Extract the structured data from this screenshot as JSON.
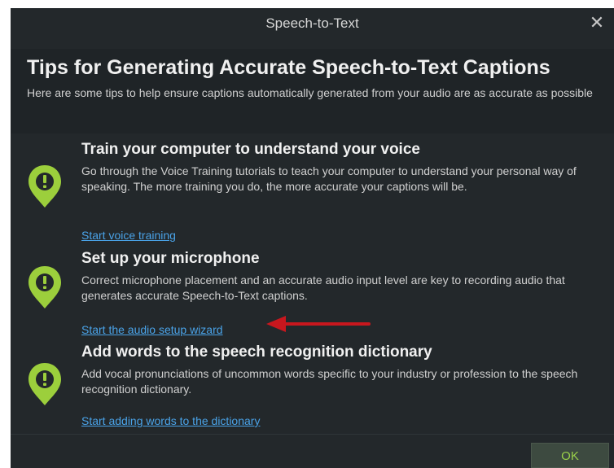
{
  "window": {
    "title": "Speech-to-Text",
    "close_icon": "close-icon"
  },
  "header": {
    "title": "Tips for Generating Accurate Speech-to-Text Captions",
    "description": "Here are some tips to help ensure captions automatically generated from your audio are as accurate as possible"
  },
  "tips": [
    {
      "icon": "exclamation-pin-icon",
      "title": "Train your computer to understand your voice",
      "description": "Go through the Voice Training tutorials to teach your computer to understand your personal way of speaking. The more training you do, the more accurate your captions will be.",
      "link": "Start voice training"
    },
    {
      "icon": "exclamation-pin-icon",
      "title": "Set up your microphone",
      "description": "Correct microphone placement and an accurate audio input level are key to recording audio that generates accurate Speech-to-Text captions.",
      "link": "Start the audio setup wizard"
    },
    {
      "icon": "exclamation-pin-icon",
      "title": "Add words to the speech recognition dictionary",
      "description": "Add vocal pronunciations of uncommon words specific to your industry or profession to the speech recognition dictionary.",
      "link": "Start adding words to the dictionary"
    }
  ],
  "footer": {
    "ok_label": "OK"
  },
  "colors": {
    "background": "#23282b",
    "icon_green": "#9ccf3c",
    "link": "#4aa3e8",
    "annotation_arrow": "#c8171e"
  }
}
